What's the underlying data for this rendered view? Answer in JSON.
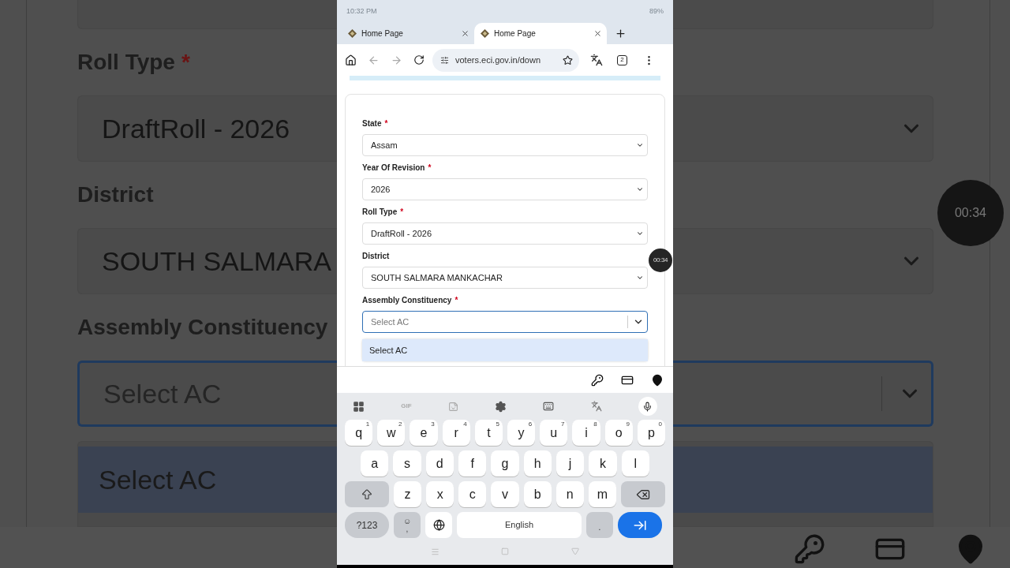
{
  "backdrop": {
    "fields": [
      {
        "label": "Roll Type",
        "mark": "*",
        "value": "DraftRoll - 2026",
        "focused": false
      },
      {
        "label": "District",
        "value": "SOUTH SALMARA",
        "focused": false
      },
      {
        "label": "Assembly Constituency",
        "placeholder": "Select AC",
        "focused": true
      }
    ],
    "option": {
      "label": "Select AC",
      "selected": true
    },
    "timer": "00:34"
  },
  "status_bar": {
    "time": "10:32 PM",
    "battery": "89%"
  },
  "tabs": [
    {
      "title": "Home Page",
      "selected": false
    },
    {
      "title": "Home Page",
      "selected": true
    }
  ],
  "toolbar": {
    "url": "voters.eci.gov.in/down",
    "tab_count": "2"
  },
  "form": {
    "fields": [
      {
        "label": "State",
        "mark": "*",
        "value": "Assam",
        "focused": false
      },
      {
        "label": "Year Of Revision",
        "mark": "*",
        "value": "2026",
        "focused": false
      },
      {
        "label": "Roll Type",
        "mark": "*",
        "value": "DraftRoll - 2026",
        "focused": false
      },
      {
        "label": "District",
        "value": "SOUTH SALMARA MANKACHAR",
        "focused": false
      },
      {
        "label": "Assembly Constituency",
        "mark": "*",
        "placeholder": "Select AC",
        "focused": true
      }
    ],
    "options": [
      {
        "label": "Select AC",
        "selected": true
      }
    ]
  },
  "timer": "00:34",
  "keyboard": {
    "gif": "GIF",
    "rows": [
      [
        {
          "kind": "char",
          "label": "q",
          "hint": "1"
        },
        {
          "kind": "char",
          "label": "w",
          "hint": "2"
        },
        {
          "kind": "char",
          "label": "e",
          "hint": "3"
        },
        {
          "kind": "char",
          "label": "r",
          "hint": "4"
        },
        {
          "kind": "char",
          "label": "t",
          "hint": "5"
        },
        {
          "kind": "char",
          "label": "y",
          "hint": "6"
        },
        {
          "kind": "char",
          "label": "u",
          "hint": "7"
        },
        {
          "kind": "char",
          "label": "i",
          "hint": "8"
        },
        {
          "kind": "char",
          "label": "o",
          "hint": "9"
        },
        {
          "kind": "char",
          "label": "p",
          "hint": "0"
        }
      ],
      [
        {
          "kind": "char",
          "label": "a"
        },
        {
          "kind": "char",
          "label": "s"
        },
        {
          "kind": "char",
          "label": "d"
        },
        {
          "kind": "char",
          "label": "f"
        },
        {
          "kind": "char",
          "label": "g"
        },
        {
          "kind": "char",
          "label": "h"
        },
        {
          "kind": "char",
          "label": "j"
        },
        {
          "kind": "char",
          "label": "k"
        },
        {
          "kind": "char",
          "label": "l"
        }
      ],
      [
        {
          "kind": "shift"
        },
        {
          "kind": "char",
          "label": "z"
        },
        {
          "kind": "char",
          "label": "x"
        },
        {
          "kind": "char",
          "label": "c"
        },
        {
          "kind": "char",
          "label": "v"
        },
        {
          "kind": "char",
          "label": "b"
        },
        {
          "kind": "char",
          "label": "n"
        },
        {
          "kind": "char",
          "label": "m"
        },
        {
          "kind": "backspace"
        }
      ],
      [
        {
          "kind": "symbols",
          "label": "?123"
        },
        {
          "kind": "emoji",
          "label": "☺",
          "hint": ","
        },
        {
          "kind": "globe"
        },
        {
          "kind": "space",
          "label": "English"
        },
        {
          "kind": "period",
          "label": "."
        },
        {
          "kind": "enter"
        }
      ]
    ]
  }
}
